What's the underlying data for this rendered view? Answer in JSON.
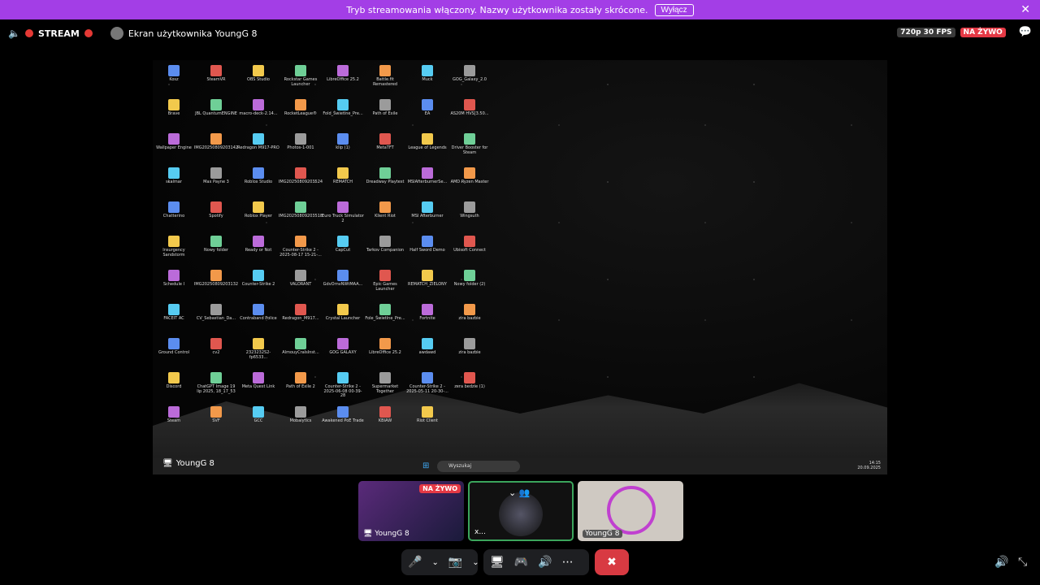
{
  "notice": {
    "text": "Tryb streamowania włączony. Nazwy użytkownika zostały skrócone.",
    "button": "Wyłącz"
  },
  "topbar": {
    "stream": "STREAM",
    "screen_title": "Ekran użytkownika YoungG 8",
    "quality": "720p 30 FPS",
    "live": "NA ŻYWO"
  },
  "desktop_icons": [
    "Kosz",
    "SteamVR",
    "OBS Studio",
    "Rockstar Games Launcher",
    "LibreOffice 25.2",
    "Battle.fit Remastered",
    "Muck",
    "GOG_Galaxy_2.0",
    "",
    "",
    "Brave",
    "JBL QuantumENGINE",
    "macro-deck-2.14...",
    "RocketLeague®",
    "Fold_Świetlne_Pre...",
    "Path of Exile",
    "EA",
    "AS20M HVS[3.50...",
    "",
    "",
    "Wallpaper Engine",
    "IMG20250809203142",
    "Redragon M917-PRO",
    "Photos-1-001",
    "klip (1)",
    "MetaTFT",
    "League of Legends",
    "Driver Booster for Steam",
    "",
    "",
    "skalmar",
    "Max Payne 3",
    "Roblox Studio",
    "IMG20250809203524",
    "REMATCH",
    "Dreadway Playtest",
    "MSIAfterburnerSe...",
    "AMD Ryzen Master",
    "",
    "",
    "Chatterino",
    "Spotify",
    "Roblox Player",
    "IMG20250809203518",
    "Euro Truck Simulator 2",
    "Klient Riot",
    "MSI Afterburner",
    "Wingsuth",
    "",
    "",
    "Insurgency Sandstorm",
    "Nowy folder",
    "Ready or Not",
    "Counter-Strike 2 - 2025-08-17 15-21-...",
    "CapCut",
    "Tarkov Companion",
    "Half Sword Demo",
    "Ubisoft Connect",
    "",
    "",
    "Schedule I",
    "IMG20250809203132",
    "Counter-Strike 2",
    "VALORANT",
    "GdvOrnvNWtMAA...",
    "Epic Games Launcher",
    "REMATCH_ZIELONY",
    "Nowy folder (2)",
    "",
    "",
    "FACEIT AC",
    "CV_Sebastian_Da...",
    "Contraband Police",
    "Redragon_M917...",
    "Crystal Launcher",
    "Fole_Świetlne_Pre...",
    "Fortnite",
    "zira bazbie",
    "",
    "",
    "Ground Control",
    "cv2",
    "2323232S2-fp6533...",
    "AlmouyCralsInst...",
    "GOG GALAXY",
    "LibreOffice 25.2",
    "awdawd",
    "zira bazbie",
    "",
    "",
    "Discord",
    "ChatGPT Image 19 lip 2025, 18_17_53",
    "Meta Quest Link",
    "Path of Exile 2",
    "Counter-Strike 2 - 2025-06-08 00-39-28",
    "Supermarket Together",
    "Counter-Strike 2 - 2025-05-11 20-30-...",
    "zera bedzie (1)",
    "",
    "",
    "Steam",
    "SVF",
    "GCC",
    "Mobalytics",
    "Awakened PoE Trade",
    "KBIAW",
    "Riot Client",
    "",
    "",
    ""
  ],
  "taskbar": {
    "search_placeholder": "Wyszukaj",
    "time": "14:15",
    "date": "20.09.2025"
  },
  "stage_label": "YoungG 8",
  "tiles": [
    {
      "label": "YoungG 8",
      "live": "NA ŻYWO"
    },
    {
      "label": "x..."
    },
    {
      "label": "YoungG 8"
    }
  ]
}
